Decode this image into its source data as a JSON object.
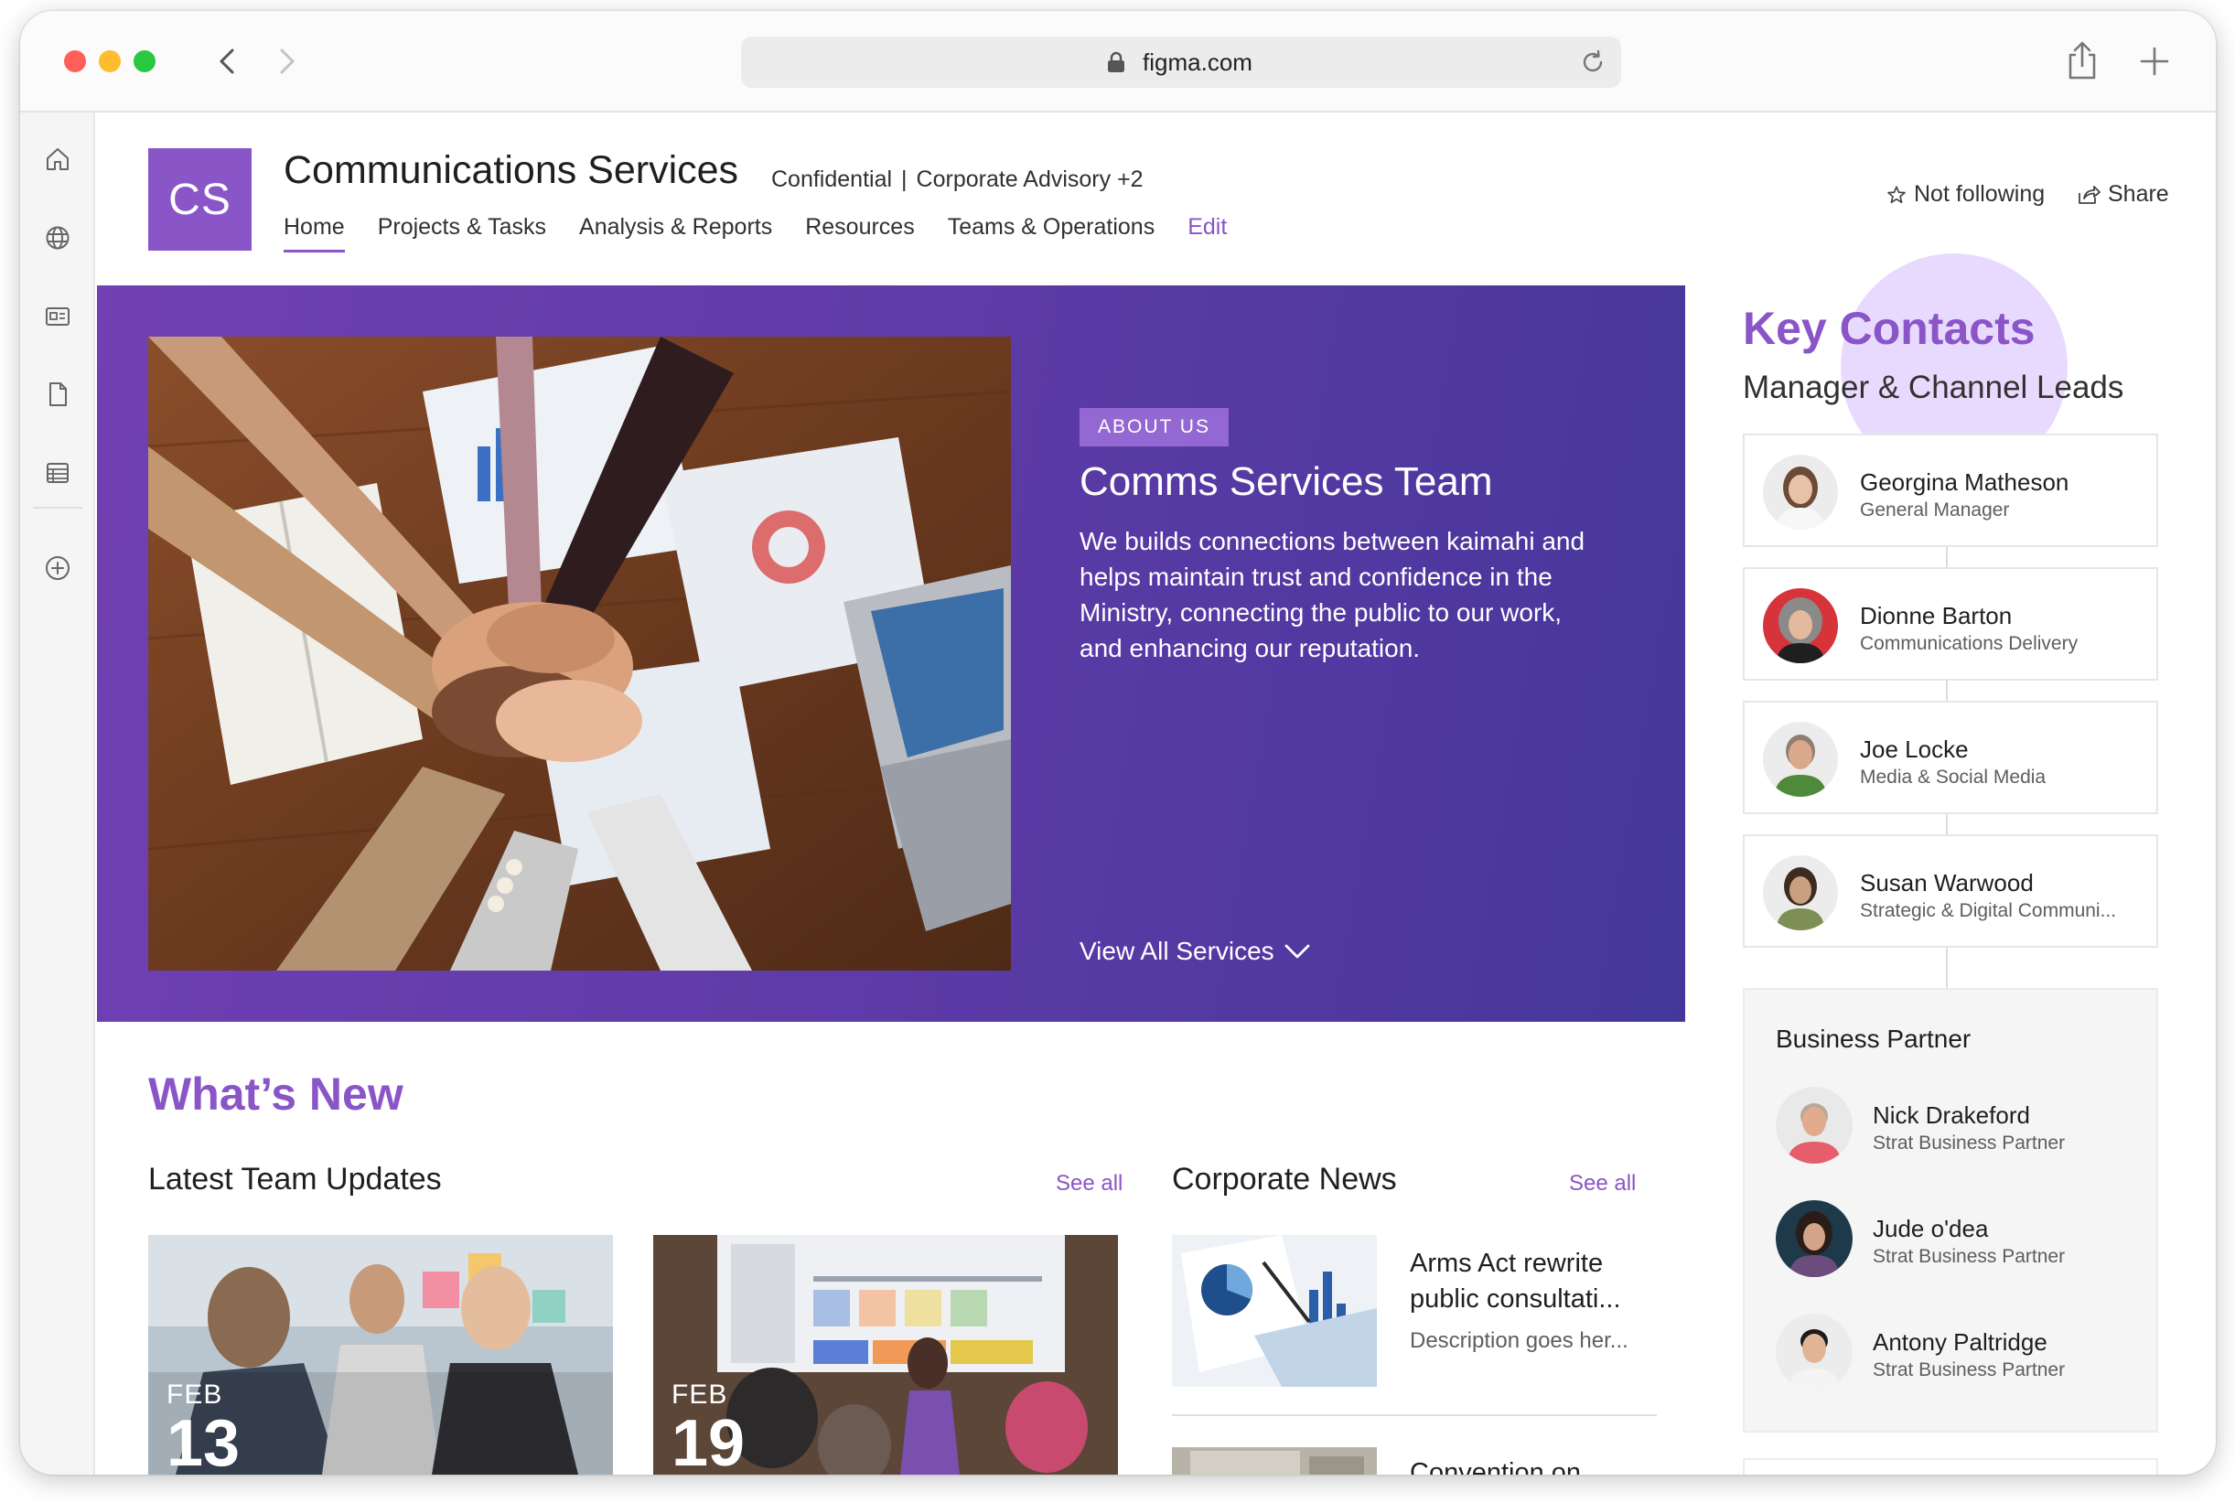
{
  "browser": {
    "url": "figma.com"
  },
  "site": {
    "logo_initials": "CS",
    "title": "Communications Services",
    "meta": {
      "classification": "Confidential",
      "separator": "|",
      "groups": "Corporate Advisory +2"
    },
    "nav": [
      {
        "label": "Home",
        "active": true
      },
      {
        "label": "Projects & Tasks"
      },
      {
        "label": "Analysis & Reports"
      },
      {
        "label": "Resources"
      },
      {
        "label": "Teams & Operations"
      },
      {
        "label": "Edit"
      }
    ],
    "follow_label": "Not following",
    "share_label": "Share",
    "accent_color": "#8a55c7"
  },
  "hero": {
    "tag": "ABOUT US",
    "title": "Comms Services Team",
    "body": "We builds connections between kaimahi and helps maintain trust and confidence in the Ministry, connecting the public to our work, and enhancing our reputation.",
    "cta": "View All Services"
  },
  "whats_new": {
    "title": "What’s New",
    "team_updates": {
      "title": "Latest Team Updates",
      "see_all": "See all",
      "items": [
        {
          "month": "FEB",
          "day": "13"
        },
        {
          "month": "FEB",
          "day": "19"
        }
      ]
    },
    "corporate_news": {
      "title": "Corporate News",
      "see_all": "See all",
      "items": [
        {
          "title": "Arms Act rewrite public consultati...",
          "description": "Description goes her..."
        },
        {
          "title": "Convention on..."
        }
      ]
    }
  },
  "key_contacts": {
    "title": "Key Contacts",
    "subtitle": "Manager & Channel Leads",
    "contacts": [
      {
        "name": "Georgina Matheson",
        "role": "General Manager"
      },
      {
        "name": "Dionne Barton",
        "role": "Communications Delivery"
      },
      {
        "name": "Joe Locke",
        "role": "Media & Social Media"
      },
      {
        "name": "Susan Warwood",
        "role": "Strategic & Digital Communi..."
      }
    ],
    "business_partner": {
      "title": "Business Partner",
      "people": [
        {
          "name": "Nick Drakeford",
          "role": "Strat Business Partner"
        },
        {
          "name": "Jude o'dea",
          "role": "Strat Business Partner"
        },
        {
          "name": "Antony Paltridge",
          "role": "Strat Business Partner"
        }
      ]
    }
  }
}
